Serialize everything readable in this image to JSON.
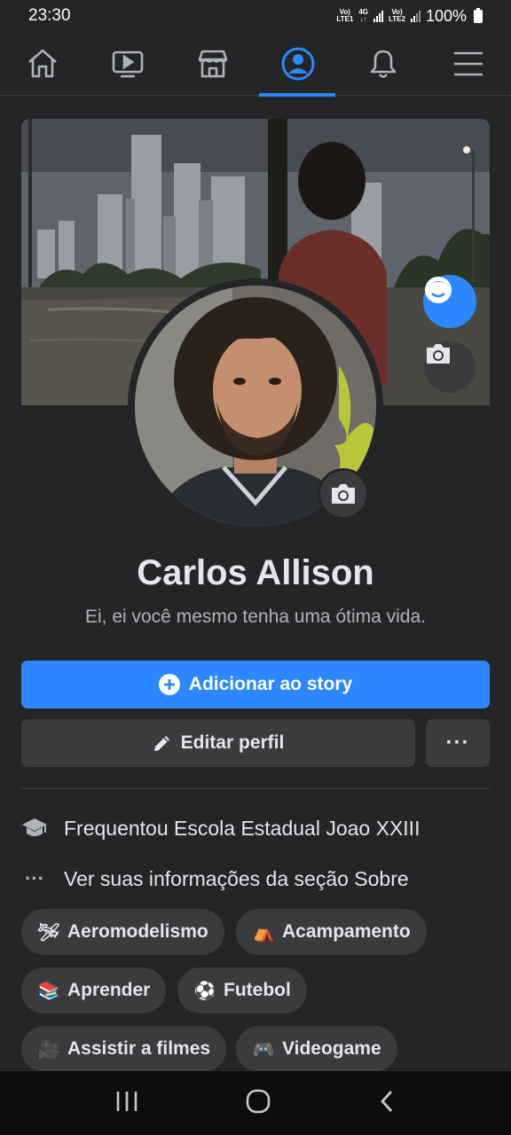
{
  "status_bar": {
    "time": "23:30",
    "sim1_label_top": "Vo)",
    "sim1_label_bottom": "LTE1",
    "net_label_top": "4G",
    "net_label_bottom": "↓↑",
    "sim2_label_top": "Vo)",
    "sim2_label_bottom": "LTE2",
    "battery": "100%"
  },
  "nav": {
    "tabs": [
      {
        "icon": "home-icon"
      },
      {
        "icon": "video-icon"
      },
      {
        "icon": "marketplace-icon"
      },
      {
        "icon": "profile-icon",
        "active": true
      },
      {
        "icon": "bell-icon"
      },
      {
        "icon": "menu-icon"
      }
    ],
    "accent": "#2d88ff"
  },
  "profile": {
    "name": "Carlos Allison",
    "bio": "Ei, ei você mesmo tenha uma ótima vida."
  },
  "actions": {
    "story_label": "Adicionar ao story",
    "edit_label": "Editar perfil",
    "more_label": "···"
  },
  "about": {
    "education": "Frequentou Escola Estadual Joao XXIII",
    "see_more": "Ver suas informações da seção Sobre",
    "more_dots": "···"
  },
  "hobbies": [
    {
      "emoji": "🛩",
      "label": "Aeromodelismo"
    },
    {
      "emoji": "⛺",
      "label": "Acampamento"
    },
    {
      "emoji": "📚",
      "label": "Aprender"
    },
    {
      "emoji": "⚽",
      "label": "Futebol"
    },
    {
      "emoji": "🎥",
      "label": "Assistir a filmes"
    },
    {
      "emoji": "🎮",
      "label": "Videogame"
    }
  ]
}
